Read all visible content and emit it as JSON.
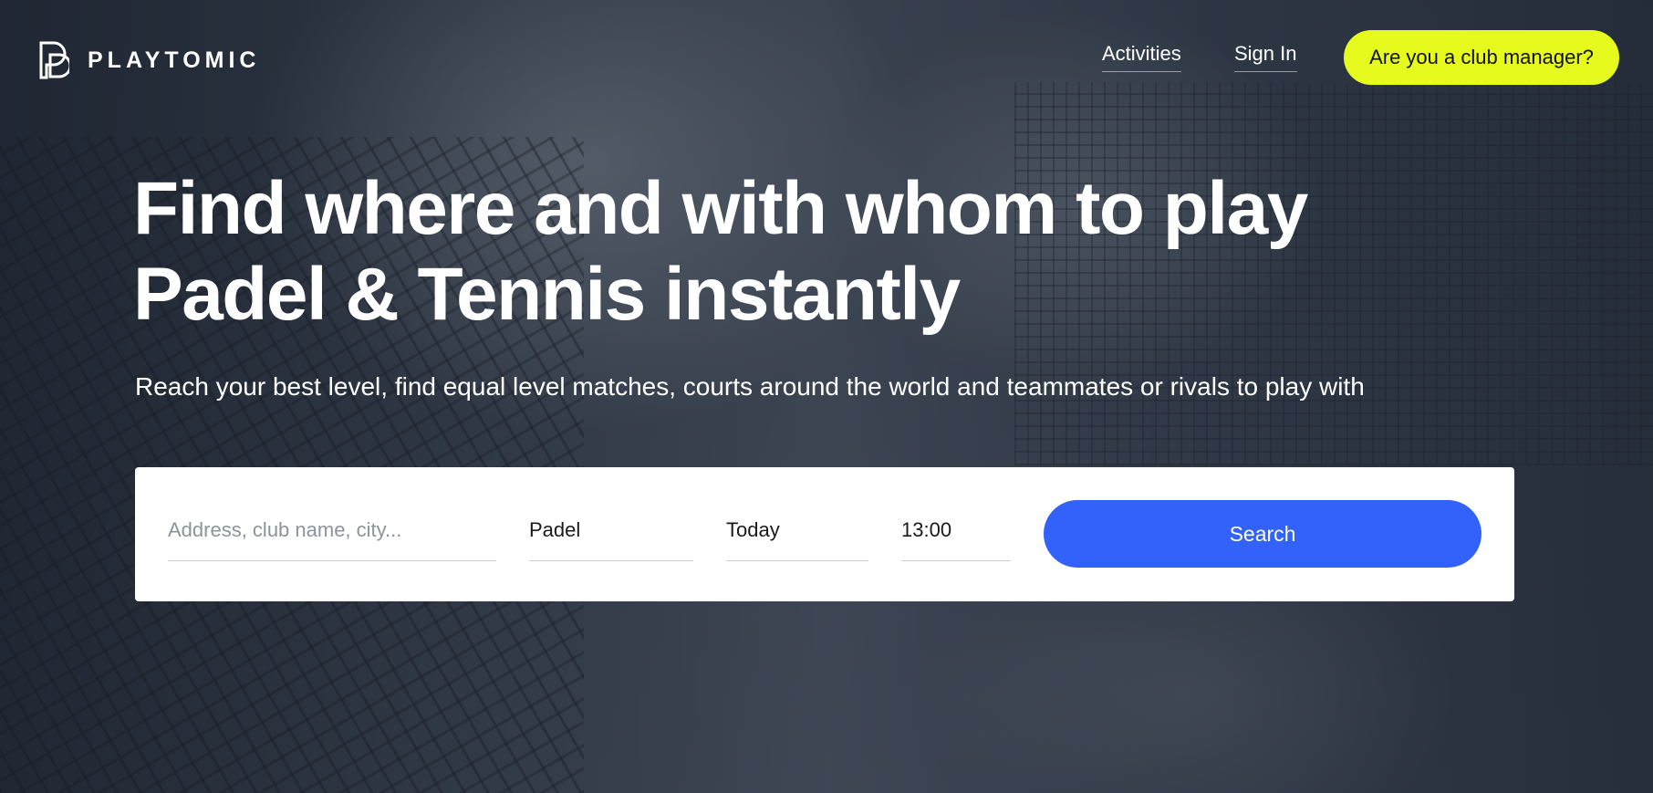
{
  "brand": {
    "name": "PLAYTOMIC"
  },
  "nav": {
    "activities": "Activities",
    "sign_in": "Sign In",
    "club_manager": "Are you a club manager?"
  },
  "hero": {
    "title": "Find where and with whom to play Padel & Tennis instantly",
    "subtitle": "Reach your best level, find equal level matches, courts around the world and teammates or rivals to play with"
  },
  "search": {
    "address_placeholder": "Address, club name, city...",
    "sport": "Padel",
    "date": "Today",
    "time": "13:00",
    "button": "Search"
  },
  "colors": {
    "accent_yellow": "#e6fa1e",
    "primary_blue": "#3362fb"
  }
}
